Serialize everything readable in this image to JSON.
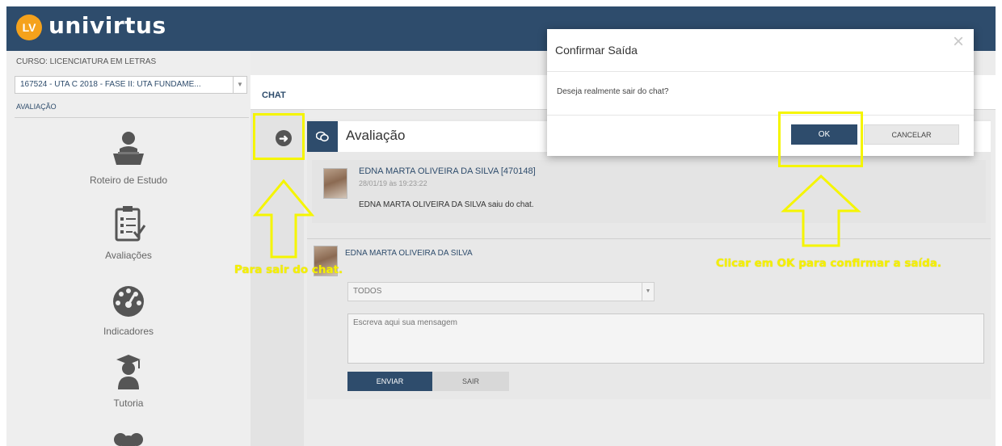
{
  "app": {
    "logo_badge": "LV",
    "logo_name": "univirtus"
  },
  "sidebar": {
    "course_label": "CURSO: LICENCIATURA EM LETRAS",
    "course_select": "167524 - UTA C 2018 - FASE II: UTA FUNDAME...",
    "current_link": "AVALIAÇÃO",
    "items": [
      {
        "label": "Roteiro de Estudo",
        "icon": "student-desk-icon"
      },
      {
        "label": "Avaliações",
        "icon": "clipboard-checklist-icon"
      },
      {
        "label": "Indicadores",
        "icon": "speedometer-icon"
      },
      {
        "label": "Tutoria",
        "icon": "graduate-icon"
      },
      {
        "label": "",
        "icon": "group-icon"
      }
    ]
  },
  "chat": {
    "section_title": "CHAT",
    "panel_title": "Avaliação",
    "message": {
      "author": "EDNA MARTA OLIVEIRA DA SILVA [470148]",
      "timestamp": "28/01/19 às 19:23:22",
      "text": "EDNA MARTA OLIVEIRA DA SILVA saiu do chat."
    },
    "compose": {
      "author": "EDNA MARTA OLIVEIRA DA SILVA",
      "recipient": "TODOS",
      "message_placeholder": "Escreva aqui sua mensagem",
      "send_label": "ENVIAR",
      "exit_label": "SAIR"
    }
  },
  "modal": {
    "title": "Confirmar Saída",
    "close_symbol": "×",
    "body": "Deseja realmente sair do chat?",
    "ok_label": "OK",
    "cancel_label": "CANCELAR"
  },
  "annotations": {
    "left_caption": "Para sair do chat.",
    "right_caption": "Clicar em OK para confirmar a saída."
  },
  "colors": {
    "brand_navy": "#2e4c6c",
    "logo_orange": "#f5a21c",
    "annotation_yellow": "#f5f500"
  }
}
